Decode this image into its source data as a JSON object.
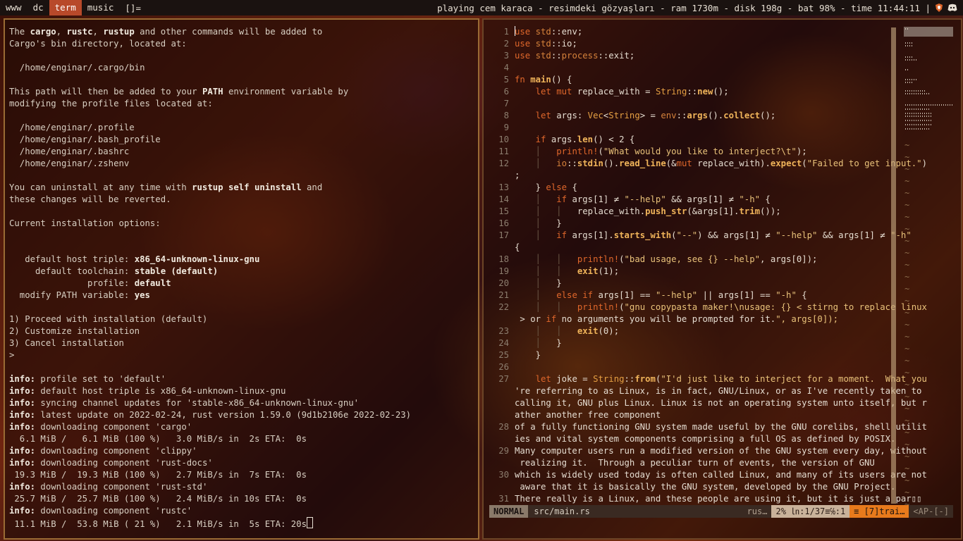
{
  "bar": {
    "workspaces": [
      "www",
      "dc",
      "term",
      "music"
    ],
    "layout": "[]=",
    "status": "playing cem karaca - resimdeki gözyaşları - ram 1730m - disk 198g - bat 98% - time 11:44:11 |"
  },
  "terminal": {
    "lines": [
      "The **cargo**, **rustc**, **rustup** and other commands will be added to",
      "Cargo's bin directory, located at:",
      "",
      "  /home/enginar/.cargo/bin",
      "",
      "This path will then be added to your **PATH** environment variable by",
      "modifying the profile files located at:",
      "",
      "  /home/enginar/.profile",
      "  /home/enginar/.bash_profile",
      "  /home/enginar/.bashrc",
      "  /home/enginar/.zshenv",
      "",
      "You can uninstall at any time with **rustup self uninstall** and",
      "these changes will be reverted.",
      "",
      "Current installation options:",
      "",
      "",
      "   default host triple: **x86_64-unknown-linux-gnu**",
      "     default toolchain: **stable (default)**",
      "               profile: **default**",
      "  modify PATH variable: **yes**",
      "",
      "1) Proceed with installation (default)",
      "2) Customize installation",
      "3) Cancel installation",
      ">",
      "",
      "**info:** profile set to 'default'",
      "**info:** default host triple is x86_64-unknown-linux-gnu",
      "**info:** syncing channel updates for 'stable-x86_64-unknown-linux-gnu'",
      "**info:** latest update on 2022-02-24, rust version 1.59.0 (9d1b2106e 2022-02-23)",
      "**info:** downloading component 'cargo'",
      "  6.1 MiB /   6.1 MiB (100 %)   3.0 MiB/s in  2s ETA:  0s",
      "**info:** downloading component 'clippy'",
      "**info:** downloading component 'rust-docs'",
      " 19.3 MiB /  19.3 MiB (100 %)   2.7 MiB/s in  7s ETA:  0s",
      "**info:** downloading component 'rust-std'",
      " 25.7 MiB /  25.7 MiB (100 %)   2.4 MiB/s in 10s ETA:  0s",
      "**info:** downloading component 'rustc'",
      " 11.1 MiB /  53.8 MiB ( 21 %)   2.1 MiB/s in  5s ETA: 20s"
    ]
  },
  "editor": {
    "lines": [
      {
        "n": "1",
        "code": "use std::env;"
      },
      {
        "n": "2",
        "code": "use std::io;"
      },
      {
        "n": "3",
        "code": "use std::process::exit;"
      },
      {
        "n": "4",
        "code": ""
      },
      {
        "n": "5",
        "code": "fn main() {"
      },
      {
        "n": "6",
        "code": "    let mut replace_with = String::new();"
      },
      {
        "n": "7",
        "code": ""
      },
      {
        "n": "8",
        "code": "    let args: Vec<String> = env::args().collect();"
      },
      {
        "n": "9",
        "code": ""
      },
      {
        "n": "10",
        "code": "    if args.len() < 2 {"
      },
      {
        "n": "11",
        "code": "    │   println!(\"What would you like to interject?\\t\");"
      },
      {
        "n": "12",
        "code": "    │   io::stdin().read_line(&mut replace_with).expect(\"Failed to get input.\")"
      },
      {
        "n": "",
        "code": ";"
      },
      {
        "n": "13",
        "code": "    } else {"
      },
      {
        "n": "14",
        "code": "    │   if args[1] ≠ \"--help\" && args[1] ≠ \"-h\" {"
      },
      {
        "n": "15",
        "code": "    │   │   replace_with.push_str(&args[1].trim());"
      },
      {
        "n": "16",
        "code": "    │   }"
      },
      {
        "n": "17",
        "code": "    │   if args[1].starts_with(\"--\") && args[1] ≠ \"--help\" && args[1] ≠ \"-h\""
      },
      {
        "n": "",
        "code": "{"
      },
      {
        "n": "18",
        "code": "    │   │   println!(\"bad usage, see {} --help\", args[0]);"
      },
      {
        "n": "19",
        "code": "    │   │   exit(1);"
      },
      {
        "n": "20",
        "code": "    │   }"
      },
      {
        "n": "21",
        "code": "    │   else if args[1] == \"--help\" || args[1] == \"-h\" {"
      },
      {
        "n": "22",
        "code": "    │   │   println!(\"gnu copypasta maker!\\nusage: {} < stirng to replace linux"
      },
      {
        "n": "",
        "code": " > or if no arguments you will be prompted for it.\", args[0]);"
      },
      {
        "n": "23",
        "code": "    │   │   exit(0);"
      },
      {
        "n": "24",
        "code": "    │   }"
      },
      {
        "n": "25",
        "code": "    }"
      },
      {
        "n": "26",
        "code": ""
      },
      {
        "n": "27",
        "code": "    let joke = String::from(\"I'd just like to interject for a moment.  What you"
      },
      {
        "n": "",
        "code": "'re referring to as Linux, is in fact, GNU/Linux, or as I've recently taken to"
      },
      {
        "n": "",
        "code": "calling it, GNU plus Linux. Linux is not an operating system unto itself, but r"
      },
      {
        "n": "",
        "code": "ather another free component"
      },
      {
        "n": "28",
        "code": "of a fully functioning GNU system made useful by the GNU corelibs, shell utilit"
      },
      {
        "n": "",
        "code": "ies and vital system components comprising a full OS as defined by POSIX."
      },
      {
        "n": "29",
        "code": "Many computer users run a modified version of the GNU system every day, without"
      },
      {
        "n": "",
        "code": " realizing it.  Through a peculiar turn of events, the version of GNU"
      },
      {
        "n": "30",
        "code": "which is widely used today is often called Linux, and many of its users are not"
      },
      {
        "n": "",
        "code": " aware that it is basically the GNU system, developed by the GNU Project."
      },
      {
        "n": "31",
        "code": "There really is a Linux, and these people are using it, but it is just a par▯▯"
      }
    ],
    "tildes": [
      "~",
      "~",
      "~",
      "~",
      "~",
      "~",
      "~",
      "~",
      "~",
      "~",
      "~",
      "~",
      "~",
      "~",
      "~",
      "~",
      "~",
      "~",
      "~",
      "~",
      "~",
      "~",
      "~",
      "~",
      "~",
      "~",
      "~",
      "~",
      "~",
      "~",
      "~"
    ],
    "statusline": {
      "mode": "NORMAL",
      "file": "src/main.rs",
      "filetype": "rus…",
      "position": "2% ㏑:1/37≡℅:1",
      "warnings": "≡ [7]trai…",
      "ap": "<AP-[-]"
    }
  },
  "colors": {
    "active_workspace": "#b8492a",
    "active_border": "#9a6b34",
    "mode": "#8a7a6a",
    "warn": "#e87a1c"
  }
}
